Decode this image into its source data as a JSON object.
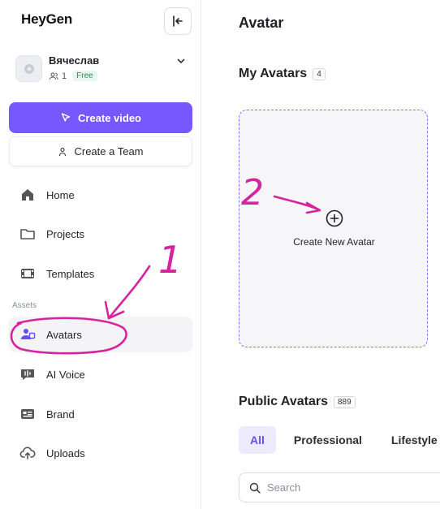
{
  "sidebar": {
    "logo": "HeyGen",
    "account": {
      "name": "Вячеслав",
      "members": "1",
      "plan": "Free"
    },
    "create_video_label": "Create video",
    "create_team_label": "Create a Team",
    "nav": [
      {
        "label": "Home",
        "icon": "home-icon"
      },
      {
        "label": "Projects",
        "icon": "folder-icon"
      },
      {
        "label": "Templates",
        "icon": "film-icon"
      }
    ],
    "assets_label": "Assets",
    "assets": [
      {
        "label": "Avatars",
        "icon": "avatar-icon",
        "active": true
      },
      {
        "label": "AI Voice",
        "icon": "voice-icon"
      },
      {
        "label": "Brand",
        "icon": "brand-icon"
      },
      {
        "label": "Uploads",
        "icon": "upload-icon"
      }
    ]
  },
  "main": {
    "title": "Avatar",
    "my_avatars": {
      "label": "My Avatars",
      "count": "4"
    },
    "create_new_label": "Create New Avatar",
    "public_avatars": {
      "label": "Public Avatars",
      "count": "889"
    },
    "tabs": [
      "All",
      "Professional",
      "Lifestyle"
    ],
    "search": {
      "placeholder": "Search",
      "value": ""
    }
  },
  "annotations": {
    "step1": "1",
    "step2": "2"
  },
  "colors": {
    "accent": "#7559ff",
    "annotation": "#d6249f"
  }
}
